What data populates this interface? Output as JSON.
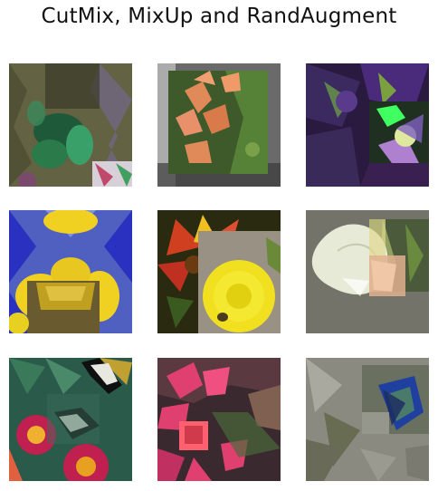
{
  "figure": {
    "title": "CutMix, MixUp and RandAugment"
  },
  "images": [
    {
      "subject": "augmented-flower-clover-mirror",
      "palette": [
        "#6d6a4a",
        "#1e5a3a",
        "#3aa06a",
        "#8a6aa0",
        "#c0486a"
      ]
    },
    {
      "subject": "augmented-flower-orange-trumpet",
      "palette": [
        "#3f5a2a",
        "#e08a5a",
        "#5a8a3a",
        "#9a9aa0",
        "#2a3a20"
      ]
    },
    {
      "subject": "augmented-flower-purple-petals",
      "palette": [
        "#2a1a40",
        "#4a2a7a",
        "#6a9a4a",
        "#40ff60",
        "#b080d0"
      ]
    },
    {
      "subject": "augmented-flower-yellow-kaleido",
      "palette": [
        "#2a30c0",
        "#f0d020",
        "#8090e0",
        "#6a5a30",
        "#c0a020"
      ]
    },
    {
      "subject": "augmented-flower-gazania-dandelion",
      "palette": [
        "#2a2a10",
        "#d04020",
        "#f0e020",
        "#a09a90",
        "#6a8a3a"
      ]
    },
    {
      "subject": "augmented-flower-white-anthurium",
      "palette": [
        "#6a6a60",
        "#e8ead8",
        "#90a060",
        "#e0b090",
        "#4a5a3a"
      ]
    },
    {
      "subject": "augmented-flower-gaillardia-butterfly",
      "palette": [
        "#2a5a4a",
        "#c02050",
        "#f0b030",
        "#101010",
        "#e8e8e0"
      ]
    },
    {
      "subject": "augmented-flower-pink-waterlily",
      "palette": [
        "#3a2a30",
        "#e04070",
        "#806050",
        "#4a6a3a",
        "#ff6070"
      ]
    },
    {
      "subject": "augmented-flower-grey-butterfly",
      "palette": [
        "#8a8a80",
        "#5a6040",
        "#b0b0a8",
        "#2040a0",
        "#4a7a6a"
      ]
    }
  ]
}
